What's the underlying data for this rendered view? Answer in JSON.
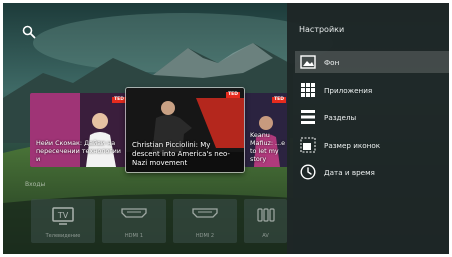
{
  "settings": {
    "title": "Настройки",
    "items": [
      {
        "label": "Фон",
        "icon": "image-icon"
      },
      {
        "label": "Приложения",
        "icon": "apps-grid-icon"
      },
      {
        "label": "Разделы",
        "icon": "sections-icon"
      },
      {
        "label": "Размер иконок",
        "icon": "icon-size-icon"
      },
      {
        "label": "Дата и время",
        "icon": "clock-icon"
      }
    ]
  },
  "videos": [
    {
      "caption": "Нейи Скомак: Дайви на пересечении технологии и",
      "badge": "TED"
    },
    {
      "caption": "Christian Picciolini: My descent into America's neo-Nazi movement",
      "badge": "TED"
    },
    {
      "caption": "Keanu Mafiuz: ...e to let my story",
      "badge": "TED"
    }
  ],
  "inputs_label": "Входы",
  "inputs": [
    {
      "label": "Телевидение",
      "icon": "tv-icon"
    },
    {
      "label": "HDMI 1",
      "icon": "hdmi-icon"
    },
    {
      "label": "HDMI 2",
      "icon": "hdmi-icon"
    },
    {
      "label": "AV",
      "icon": "av-icon"
    }
  ],
  "colors": {
    "panel": "#1e2626",
    "ted_red": "#e62b1e",
    "focus_highlight": "#ffffff"
  }
}
